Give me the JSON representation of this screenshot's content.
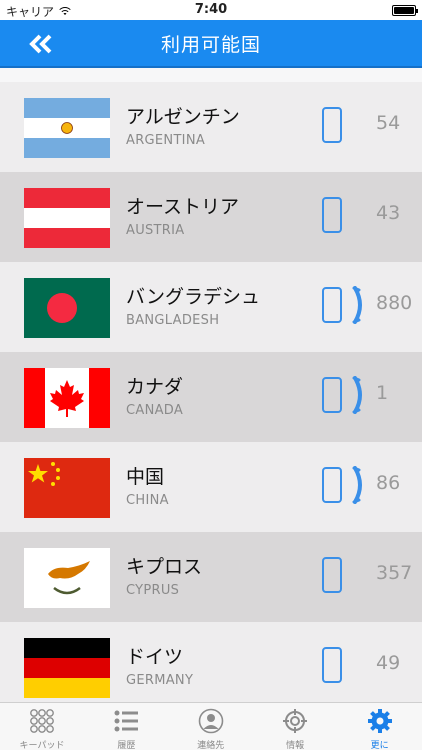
{
  "status": {
    "carrier": "キャリア",
    "time": "7:40"
  },
  "header": {
    "title": "利用可能国"
  },
  "colors": {
    "accent": "#1a8af0",
    "phone_icon": "#3a8fe8"
  },
  "countries": [
    {
      "name_ja": "アルゼンチン",
      "name_en": "ARGENTINA",
      "count": "54",
      "flag": "argentina",
      "handset": false
    },
    {
      "name_ja": "オーストリア",
      "name_en": "AUSTRIA",
      "count": "43",
      "flag": "austria",
      "handset": false
    },
    {
      "name_ja": "バングラデシュ",
      "name_en": "BANGLADESH",
      "count": "880",
      "flag": "bangladesh",
      "handset": true
    },
    {
      "name_ja": "カナダ",
      "name_en": "CANADA",
      "count": "1",
      "flag": "canada",
      "handset": true
    },
    {
      "name_ja": "中国",
      "name_en": "CHINA",
      "count": "86",
      "flag": "china",
      "handset": true
    },
    {
      "name_ja": "キプロス",
      "name_en": "CYPRUS",
      "count": "357",
      "flag": "cyprus",
      "handset": false
    },
    {
      "name_ja": "ドイツ",
      "name_en": "GERMANY",
      "count": "49",
      "flag": "germany",
      "handset": false
    }
  ],
  "tabs": [
    {
      "label": "キーパッド",
      "icon": "keypad-icon",
      "active": false
    },
    {
      "label": "履歴",
      "icon": "history-list-icon",
      "active": false
    },
    {
      "label": "連絡先",
      "icon": "contacts-icon",
      "active": false
    },
    {
      "label": "情報",
      "icon": "info-target-icon",
      "active": false
    },
    {
      "label": "更に",
      "icon": "gear-icon",
      "active": true
    }
  ]
}
